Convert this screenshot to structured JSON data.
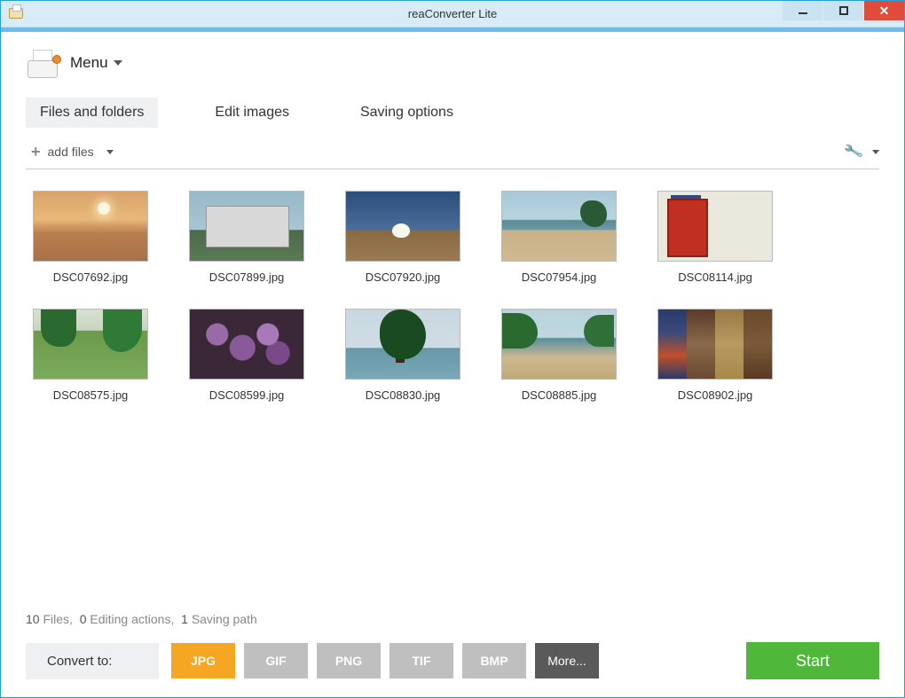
{
  "window": {
    "title": "reaConverter Lite"
  },
  "menu": {
    "label": "Menu"
  },
  "tabs": [
    {
      "label": "Files and folders",
      "active": true
    },
    {
      "label": "Edit images",
      "active": false
    },
    {
      "label": "Saving options",
      "active": false
    }
  ],
  "toolbar": {
    "add_files_label": "add files"
  },
  "files": [
    {
      "name": "DSC07692.jpg"
    },
    {
      "name": "DSC07899.jpg"
    },
    {
      "name": "DSC07920.jpg"
    },
    {
      "name": "DSC07954.jpg"
    },
    {
      "name": "DSC08114.jpg"
    },
    {
      "name": "DSC08575.jpg"
    },
    {
      "name": "DSC08599.jpg"
    },
    {
      "name": "DSC08830.jpg"
    },
    {
      "name": "DSC08885.jpg"
    },
    {
      "name": "DSC08902.jpg"
    }
  ],
  "status": {
    "files_count": "10",
    "files_word": "Files,",
    "editing_count": "0",
    "editing_word": "Editing actions,",
    "saving_count": "1",
    "saving_word": "Saving path"
  },
  "bottom": {
    "convert_label": "Convert to:",
    "formats": [
      {
        "label": "JPG",
        "selected": true
      },
      {
        "label": "GIF",
        "selected": false
      },
      {
        "label": "PNG",
        "selected": false
      },
      {
        "label": "TIF",
        "selected": false
      },
      {
        "label": "BMP",
        "selected": false
      }
    ],
    "more_label": "More...",
    "start_label": "Start"
  },
  "colors": {
    "accent_orange": "#f5a623",
    "accent_green": "#4fb83a",
    "title_blue": "#6abded"
  }
}
